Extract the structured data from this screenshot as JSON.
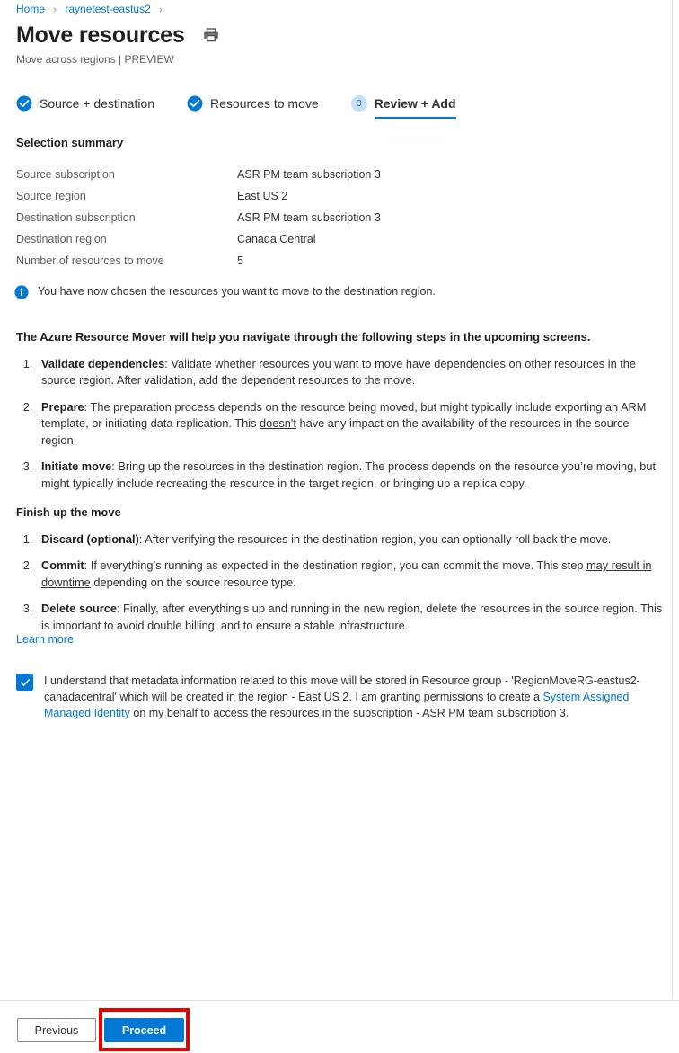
{
  "breadcrumb": {
    "items": [
      {
        "label": "Home"
      },
      {
        "label": "raynetest-eastus2"
      }
    ],
    "separator": "›"
  },
  "header": {
    "title": "Move resources",
    "subtitle": "Move across regions | PREVIEW",
    "print_icon": "printer-icon"
  },
  "steps": [
    {
      "label": "Source + destination",
      "state": "done",
      "badge": "check-icon"
    },
    {
      "label": "Resources to move",
      "state": "done",
      "badge": "check-icon"
    },
    {
      "label": "Review + Add",
      "state": "active",
      "badge": "3"
    }
  ],
  "summary": {
    "title": "Selection summary",
    "rows": [
      {
        "key": "Source subscription",
        "value": "ASR PM team subscription 3"
      },
      {
        "key": "Source region",
        "value": "East US 2"
      },
      {
        "key": "Destination subscription",
        "value": "ASR PM team subscription 3"
      },
      {
        "key": "Destination region",
        "value": "Canada Central"
      },
      {
        "key": "Number of resources to move",
        "value": "5"
      }
    ]
  },
  "info": {
    "icon": "info-icon",
    "text": "You have now chosen the resources you want to move to the destination region."
  },
  "body": {
    "lead": "The Azure Resource Mover will help you navigate through the following steps in the upcoming screens.",
    "upcoming_steps": [
      {
        "term": "Validate dependencies",
        "sep": ":",
        "text": " Validate whether resources you want to move have dependencies on other resources in the source region. After validation, add the dependent resources to the move."
      },
      {
        "term": "Prepare",
        "sep": ":",
        "text_before": " The preparation process depends on the resource being moved, but might typically include exporting an ARM template, or initiating data replication. This ",
        "underlined": "doesn't",
        "text_after": " have any impact on the availability of the resources in the source region."
      },
      {
        "term": "Initiate move",
        "sep": ":",
        "text": " Bring up the resources in the destination region. The process depends on the resource you’re moving, but might typically include recreating the resource in the target region, or bringing up a replica copy."
      }
    ],
    "finish_heading": "Finish up the move",
    "finish_steps": [
      {
        "term": "Discard (optional)",
        "sep": ":",
        "text": " After verifying the resources in the destination region, you can optionally roll back the move."
      },
      {
        "term": "Commit",
        "sep": ":",
        "text_before": " If everything’s running as expected in the destination region, you can commit the move. This step ",
        "underlined": "may result in downtime",
        "text_after": " depending on the source resource type."
      },
      {
        "term": "Delete source",
        "sep": ":",
        "text": " Finally, after everything's up and running in the new region, delete the resources in the source region. This is important to avoid double billing, and to ensure a stable infrastructure."
      }
    ],
    "learn_more": "Learn more"
  },
  "consent": {
    "checked": true,
    "text_part1": "I understand that metadata information related to this move will be stored in Resource group - 'RegionMoveRG-eastus2-canadacentral' which will be created in the region - East US 2. I am granting permissions to create a ",
    "link_text": "System Assigned Managed Identity",
    "text_part2": " on my behalf to access the resources in the subscription - ASR PM team subscription 3."
  },
  "footer": {
    "previous_label": "Previous",
    "proceed_label": "Proceed"
  },
  "colors": {
    "accent": "#0078d4",
    "link": "#0078d4",
    "highlight": "#e80000",
    "step_done": "#0078d4",
    "step_badge_bg": "#c7e0f4"
  }
}
